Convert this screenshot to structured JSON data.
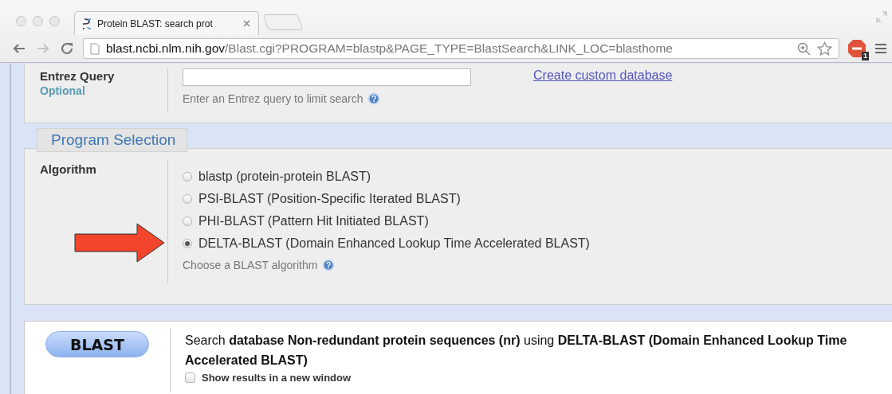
{
  "browser": {
    "tab_title": "Protein BLAST: search prot",
    "url_host": "blast.ncbi.nlm.nih.gov",
    "url_path": "/Blast.cgi?PROGRAM=blastp&PAGE_TYPE=BlastSearch&LINK_LOC=blasthome",
    "extension_badge": "1"
  },
  "entrez": {
    "label": "Entrez Query",
    "optional": "Optional",
    "hint": "Enter an Entrez query to limit search",
    "link": "Create custom database"
  },
  "program_selection": {
    "legend": "Program Selection",
    "label": "Algorithm",
    "options": [
      {
        "label": "blastp (protein-protein BLAST)",
        "selected": false
      },
      {
        "label": "PSI-BLAST (Position-Specific Iterated BLAST)",
        "selected": false
      },
      {
        "label": "PHI-BLAST (Pattern Hit Initiated BLAST)",
        "selected": false
      },
      {
        "label": "DELTA-BLAST (Domain Enhanced Lookup Time Accelerated BLAST)",
        "selected": true
      }
    ],
    "hint": "Choose a BLAST algorithm"
  },
  "submit": {
    "button": "BLAST",
    "summary": "Search **database Non-redundant protein sequences (nr)** using **DELTA-BLAST (Domain Enhanced Lookup Time Accelerated BLAST)**",
    "new_window": {
      "label": "Show results in a new window",
      "checked": false
    }
  }
}
